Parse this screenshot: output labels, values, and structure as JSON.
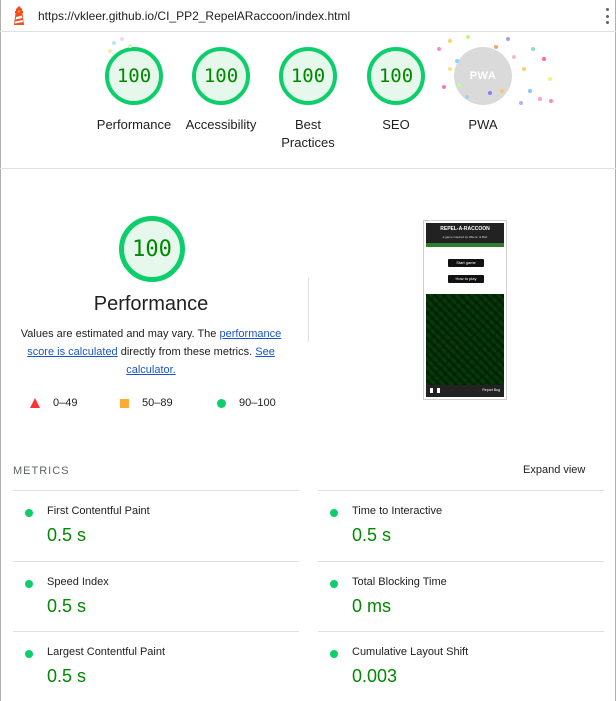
{
  "url_bar": {
    "url": "https://vkleer.github.io/CI_PP2_RepelARaccoon/index.html",
    "menu_icon": "kebab-menu-icon",
    "logo_icon": "lighthouse-icon"
  },
  "summary": {
    "gauges": [
      {
        "label": "Performance",
        "score": "100"
      },
      {
        "label": "Accessibility",
        "score": "100"
      },
      {
        "label": "Best Practices",
        "score": "100"
      },
      {
        "label": "SEO",
        "score": "100"
      }
    ],
    "pwa": {
      "label": "PWA",
      "badge_text": "PWA"
    }
  },
  "performance": {
    "score": "100",
    "title": "Performance",
    "desc_1": "Values are estimated and may vary. The ",
    "link_1": "performance score is calculated",
    "desc_2": " directly from these metrics. ",
    "link_2": "See calculator.",
    "legend": {
      "fail": "0–49",
      "average": "50–89",
      "pass": "90–100"
    }
  },
  "thumbnail": {
    "title": "REPEL-A-RACCOON",
    "subtitle": "a game inspired by Wile E. & Bob",
    "btn_start": "Start game",
    "btn_how": "How to play",
    "report_bug": "Report Bug"
  },
  "metrics": {
    "heading": "METRICS",
    "expand_label": "Expand view",
    "items": [
      {
        "name": "First Contentful Paint",
        "value": "0.5 s"
      },
      {
        "name": "Time to Interactive",
        "value": "0.5 s"
      },
      {
        "name": "Speed Index",
        "value": "0.5 s"
      },
      {
        "name": "Total Blocking Time",
        "value": "0 ms"
      },
      {
        "name": "Largest Contentful Paint",
        "value": "0.5 s"
      },
      {
        "name": "Cumulative Layout Shift",
        "value": "0.003"
      }
    ]
  },
  "colors": {
    "pass": "#0cce6b",
    "pass_text": "#008800",
    "average": "#ffaa33",
    "fail": "#ff3333",
    "link": "#1a56c8"
  }
}
